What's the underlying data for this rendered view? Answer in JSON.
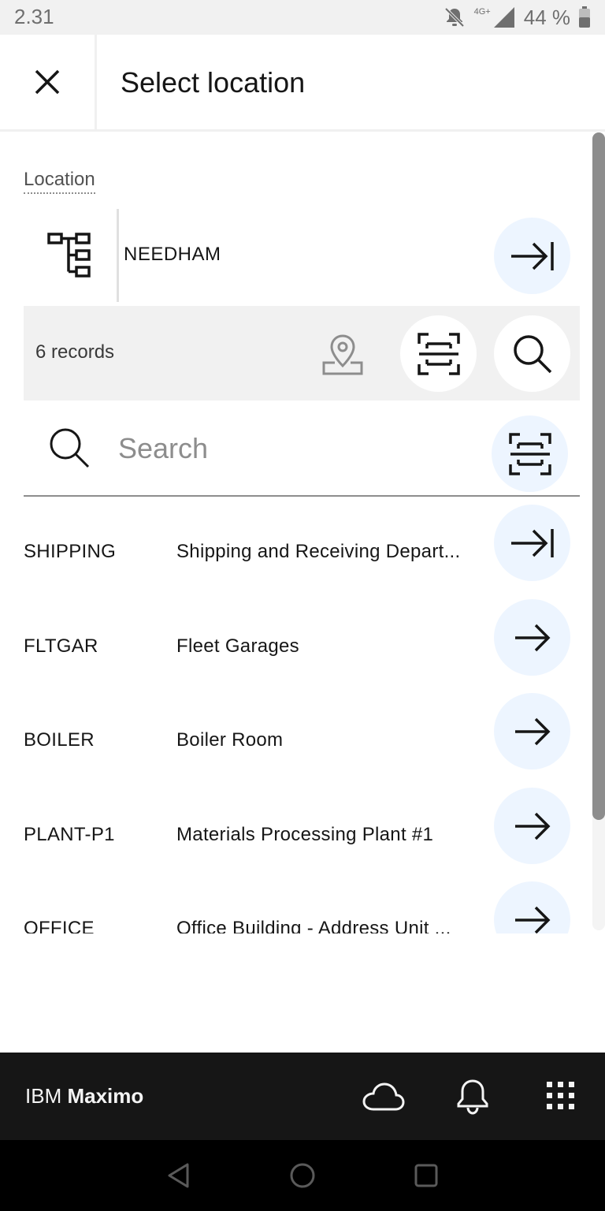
{
  "status": {
    "time": "2.31",
    "network": "4G+",
    "battery": "44 %"
  },
  "header": {
    "title": "Select location"
  },
  "location": {
    "label": "Location",
    "value": "NEEDHAM"
  },
  "toolbar": {
    "records": "6 records"
  },
  "search": {
    "placeholder": "Search"
  },
  "rows": [
    {
      "code": "SHIPPING",
      "desc": "Shipping and Receiving Depart..."
    },
    {
      "code": "FLTGAR",
      "desc": "Fleet Garages"
    },
    {
      "code": "BOILER",
      "desc": "Boiler Room"
    },
    {
      "code": "PLANT-P1",
      "desc": "Materials Processing Plant #1"
    },
    {
      "code": "OFFICE",
      "desc": "Office Building - Address Unit ..."
    }
  ],
  "footer": {
    "brand_prefix": "IBM",
    "brand_name": "Maximo"
  },
  "colors": {
    "accent_bg": "#edf5ff",
    "footer_bg": "#161616"
  }
}
